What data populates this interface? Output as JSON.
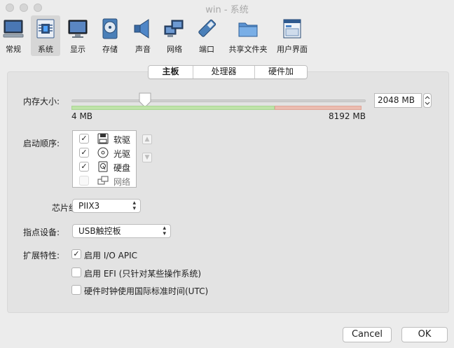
{
  "window": {
    "title": "win - 系统"
  },
  "toolbar": {
    "items": [
      {
        "label": "常规",
        "icon": "monitor-icon"
      },
      {
        "label": "系统",
        "icon": "chip-icon",
        "selected": true
      },
      {
        "label": "显示",
        "icon": "display-icon"
      },
      {
        "label": "存储",
        "icon": "disk-icon"
      },
      {
        "label": "声音",
        "icon": "speaker-icon"
      },
      {
        "label": "网络",
        "icon": "network-icon"
      },
      {
        "label": "端口",
        "icon": "port-icon"
      },
      {
        "label": "共享文件夹",
        "icon": "folder-icon"
      },
      {
        "label": "用户界面",
        "icon": "ui-window-icon"
      }
    ]
  },
  "tabs": [
    {
      "label": "主板",
      "active": true
    },
    {
      "label": "处理器"
    },
    {
      "label": "硬件加速"
    }
  ],
  "memory": {
    "label": "内存大小:",
    "value_text": "2048 MB",
    "min_label": "4 MB",
    "max_label": "8192 MB",
    "value": 2048,
    "min": 4,
    "max": 8192
  },
  "boot_order": {
    "label": "启动顺序:",
    "items": [
      {
        "label": "软驱",
        "checked": true,
        "icon": "floppy-icon"
      },
      {
        "label": "光驱",
        "checked": true,
        "icon": "optical-disc-icon"
      },
      {
        "label": "硬盘",
        "checked": true,
        "icon": "hard-disk-icon"
      },
      {
        "label": "网络",
        "checked": false,
        "icon": "network-icon"
      }
    ],
    "check_glyph": "✓"
  },
  "chipset": {
    "label": "芯片组:",
    "value": "PIIX3"
  },
  "pointing": {
    "label": "指点设备:",
    "value": "USB触控板"
  },
  "features": {
    "label": "扩展特性:",
    "items": [
      {
        "label": "启用 I/O APIC",
        "checked": true
      },
      {
        "label": "启用 EFI (只针对某些操作系统)",
        "checked": false
      },
      {
        "label": "硬件时钟使用国际标准时间(UTC)",
        "checked": false
      }
    ]
  },
  "buttons": {
    "cancel": "Cancel",
    "ok": "OK"
  }
}
